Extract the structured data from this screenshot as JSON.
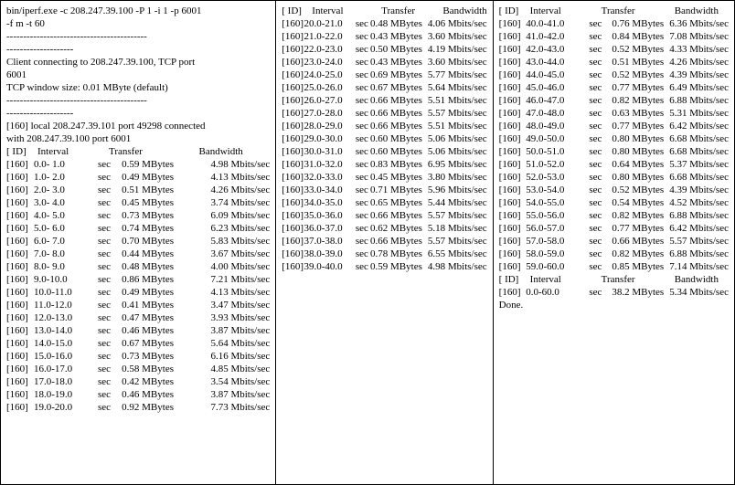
{
  "cmd": [
    "bin/iperf.exe -c 208.247.39.100 -P 1 -i 1 -p 6001",
    "-f m -t 60"
  ],
  "sep_long": "------------------------------------------",
  "sep_short": "--------------------",
  "connect": [
    "Client connecting to 208.247.39.100, TCP port",
    "6001"
  ],
  "tcpwin": "TCP window size: 0.01 MByte (default)",
  "local": [
    "[160] local 208.247.39.101 port 49298 connected",
    "with 208.247.39.100 port 6001"
  ],
  "hdr": {
    "id": "[ ID]",
    "interval": "Interval",
    "transfer": "Transfer",
    "bandwidth": "Bandwidth",
    "sec": "sec"
  },
  "units": {
    "mb": "MBytes",
    "mbps": "Mbits/sec"
  },
  "summary": {
    "id": "[160]",
    "interval": "0.0-60.0",
    "transfer": "38.2",
    "bw": "5.34"
  },
  "done": "Done.",
  "col1": [
    {
      "id": "[160]",
      "iv": "0.0- 1.0",
      "tr": "0.59",
      "bw": "4.98"
    },
    {
      "id": "[160]",
      "iv": "1.0- 2.0",
      "tr": "0.49",
      "bw": "4.13"
    },
    {
      "id": "[160]",
      "iv": "2.0- 3.0",
      "tr": "0.51",
      "bw": "4.26"
    },
    {
      "id": "[160]",
      "iv": "3.0- 4.0",
      "tr": "0.45",
      "bw": "3.74"
    },
    {
      "id": "[160]",
      "iv": "4.0- 5.0",
      "tr": "0.73",
      "bw": "6.09"
    },
    {
      "id": "[160]",
      "iv": "5.0- 6.0",
      "tr": "0.74",
      "bw": "6.23"
    },
    {
      "id": "[160]",
      "iv": "6.0- 7.0",
      "tr": "0.70",
      "bw": "5.83"
    },
    {
      "id": "[160]",
      "iv": "7.0- 8.0",
      "tr": "0.44",
      "bw": "3.67"
    },
    {
      "id": "[160]",
      "iv": "8.0- 9.0",
      "tr": "0.48",
      "bw": "4.00"
    },
    {
      "id": "[160]",
      "iv": "9.0-10.0",
      "tr": "0.86",
      "bw": "7.21"
    },
    {
      "id": "[160]",
      "iv": "10.0-11.0",
      "tr": "0.49",
      "bw": "4.13"
    },
    {
      "id": "[160]",
      "iv": "11.0-12.0",
      "tr": "0.41",
      "bw": "3.47"
    },
    {
      "id": "[160]",
      "iv": "12.0-13.0",
      "tr": "0.47",
      "bw": "3.93"
    },
    {
      "id": "[160]",
      "iv": "13.0-14.0",
      "tr": "0.46",
      "bw": "3.87"
    },
    {
      "id": "[160]",
      "iv": "14.0-15.0",
      "tr": "0.67",
      "bw": "5.64"
    },
    {
      "id": "[160]",
      "iv": "15.0-16.0",
      "tr": "0.73",
      "bw": "6.16"
    },
    {
      "id": "[160]",
      "iv": "16.0-17.0",
      "tr": "0.58",
      "bw": "4.85"
    },
    {
      "id": "[160]",
      "iv": "17.0-18.0",
      "tr": "0.42",
      "bw": "3.54"
    },
    {
      "id": "[160]",
      "iv": "18.0-19.0",
      "tr": "0.46",
      "bw": "3.87"
    },
    {
      "id": "[160]",
      "iv": "19.0-20.0",
      "tr": "0.92",
      "bw": "7.73"
    }
  ],
  "col2": [
    {
      "id": "[160]",
      "iv": "20.0-21.0",
      "tr": "0.48",
      "bw": "4.06"
    },
    {
      "id": "[160]",
      "iv": "21.0-22.0",
      "tr": "0.43",
      "bw": "3.60"
    },
    {
      "id": "[160]",
      "iv": "22.0-23.0",
      "tr": "0.50",
      "bw": "4.19"
    },
    {
      "id": "[160]",
      "iv": "23.0-24.0",
      "tr": "0.43",
      "bw": "3.60"
    },
    {
      "id": "[160]",
      "iv": "24.0-25.0",
      "tr": "0.69",
      "bw": "5.77"
    },
    {
      "id": "[160]",
      "iv": "25.0-26.0",
      "tr": "0.67",
      "bw": "5.64"
    },
    {
      "id": "[160]",
      "iv": "26.0-27.0",
      "tr": "0.66",
      "bw": "5.51"
    },
    {
      "id": "[160]",
      "iv": "27.0-28.0",
      "tr": "0.66",
      "bw": "5.57"
    },
    {
      "id": "[160]",
      "iv": "28.0-29.0",
      "tr": "0.66",
      "bw": "5.51"
    },
    {
      "id": "[160]",
      "iv": "29.0-30.0",
      "tr": "0.60",
      "bw": "5.06"
    },
    {
      "id": "[160]",
      "iv": "30.0-31.0",
      "tr": "0.60",
      "bw": "5.06"
    },
    {
      "id": "[160]",
      "iv": "31.0-32.0",
      "tr": "0.83",
      "bw": "6.95"
    },
    {
      "id": "[160]",
      "iv": "32.0-33.0",
      "tr": "0.45",
      "bw": "3.80"
    },
    {
      "id": "[160]",
      "iv": "33.0-34.0",
      "tr": "0.71",
      "bw": "5.96"
    },
    {
      "id": "[160]",
      "iv": "34.0-35.0",
      "tr": "0.65",
      "bw": "5.44"
    },
    {
      "id": "[160]",
      "iv": "35.0-36.0",
      "tr": "0.66",
      "bw": "5.57"
    },
    {
      "id": "[160]",
      "iv": "36.0-37.0",
      "tr": "0.62",
      "bw": "5.18"
    },
    {
      "id": "[160]",
      "iv": "37.0-38.0",
      "tr": "0.66",
      "bw": "5.57"
    },
    {
      "id": "[160]",
      "iv": "38.0-39.0",
      "tr": "0.78",
      "bw": "6.55"
    },
    {
      "id": "[160]",
      "iv": "39.0-40.0",
      "tr": "0.59",
      "bw": "4.98"
    }
  ],
  "col3": [
    {
      "id": "[160]",
      "iv": "40.0-41.0",
      "tr": "0.76",
      "bw": "6.36"
    },
    {
      "id": "[160]",
      "iv": "41.0-42.0",
      "tr": "0.84",
      "bw": "7.08"
    },
    {
      "id": "[160]",
      "iv": "42.0-43.0",
      "tr": "0.52",
      "bw": "4.33"
    },
    {
      "id": "[160]",
      "iv": "43.0-44.0",
      "tr": "0.51",
      "bw": "4.26"
    },
    {
      "id": "[160]",
      "iv": "44.0-45.0",
      "tr": "0.52",
      "bw": "4.39"
    },
    {
      "id": "[160]",
      "iv": "45.0-46.0",
      "tr": "0.77",
      "bw": "6.49"
    },
    {
      "id": "[160]",
      "iv": "46.0-47.0",
      "tr": "0.82",
      "bw": "6.88"
    },
    {
      "id": "[160]",
      "iv": "47.0-48.0",
      "tr": "0.63",
      "bw": "5.31"
    },
    {
      "id": "[160]",
      "iv": "48.0-49.0",
      "tr": "0.77",
      "bw": "6.42"
    },
    {
      "id": "[160]",
      "iv": "49.0-50.0",
      "tr": "0.80",
      "bw": "6.68"
    },
    {
      "id": "[160]",
      "iv": "50.0-51.0",
      "tr": "0.80",
      "bw": "6.68"
    },
    {
      "id": "[160]",
      "iv": "51.0-52.0",
      "tr": "0.64",
      "bw": "5.37"
    },
    {
      "id": "[160]",
      "iv": "52.0-53.0",
      "tr": "0.80",
      "bw": "6.68"
    },
    {
      "id": "[160]",
      "iv": "53.0-54.0",
      "tr": "0.52",
      "bw": "4.39"
    },
    {
      "id": "[160]",
      "iv": "54.0-55.0",
      "tr": "0.54",
      "bw": "4.52"
    },
    {
      "id": "[160]",
      "iv": "55.0-56.0",
      "tr": "0.82",
      "bw": "6.88"
    },
    {
      "id": "[160]",
      "iv": "56.0-57.0",
      "tr": "0.77",
      "bw": "6.42"
    },
    {
      "id": "[160]",
      "iv": "57.0-58.0",
      "tr": "0.66",
      "bw": "5.57"
    },
    {
      "id": "[160]",
      "iv": "58.0-59.0",
      "tr": "0.82",
      "bw": "6.88"
    },
    {
      "id": "[160]",
      "iv": "59.0-60.0",
      "tr": "0.85",
      "bw": "7.14"
    }
  ]
}
